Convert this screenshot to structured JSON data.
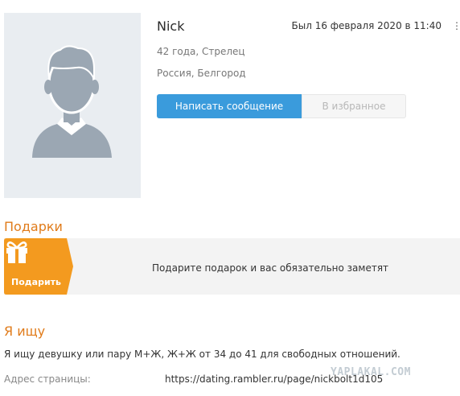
{
  "profile": {
    "name": "Nick",
    "last_seen": "Был 16 февраля 2020 в 11:40",
    "age_sign": "42 года, Стрелец",
    "location": "Россия, Белгород",
    "menu_icon": "⋮",
    "avatar_icon": "default-male-avatar-icon"
  },
  "actions": {
    "message_label": "Написать сообщение",
    "favorites_label": "В избранное"
  },
  "gifts": {
    "title": "Подарки",
    "button_label": "Подарить",
    "prompt": "Подарите подарок и вас обязательно заметят",
    "icon": "gift-icon"
  },
  "seeking": {
    "title": "Я ищу",
    "text": "Я ищу девушку или пару М+Ж, Ж+Ж от 34 до 41 для свободных отношений."
  },
  "page_address": {
    "label": "Адрес страницы:",
    "url": "https://dating.rambler.ru/page/nickbolt1d105"
  },
  "watermark": "YAPLAKAL.COM",
  "colors": {
    "accent_orange": "#e07b1a",
    "button_blue": "#3a9bdc",
    "avatar_bg": "#e9edf1",
    "avatar_figure": "#9ba7b3"
  }
}
